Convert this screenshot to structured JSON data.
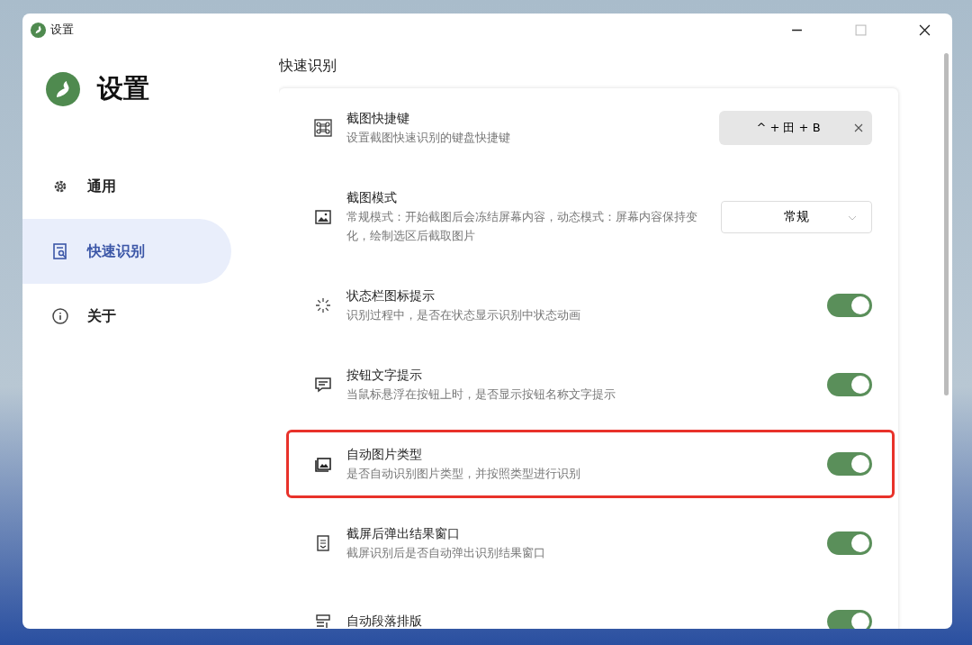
{
  "window": {
    "title": "设置"
  },
  "sidebar": {
    "title": "设置",
    "items": [
      {
        "label": "通用",
        "selected": false
      },
      {
        "label": "快速识别",
        "selected": true
      },
      {
        "label": "关于",
        "selected": false
      }
    ]
  },
  "section_title": "快速识别",
  "settings": [
    {
      "kind": "shortcut",
      "title": "截图快捷键",
      "description": "设置截图快速识别的键盘快捷键",
      "value": "^ + 田 + B"
    },
    {
      "kind": "dropdown",
      "title": "截图模式",
      "description": "常规模式：开始截图后会冻结屏幕内容，动态模式：屏幕内容保持变化，绘制选区后截取图片",
      "value": "常规"
    },
    {
      "kind": "toggle",
      "title": "状态栏图标提示",
      "description": "识别过程中，是否在状态显示识别中状态动画",
      "on": true
    },
    {
      "kind": "toggle",
      "title": "按钮文字提示",
      "description": "当鼠标悬浮在按钮上时，是否显示按钮名称文字提示",
      "on": true
    },
    {
      "kind": "toggle",
      "title": "自动图片类型",
      "description": "是否自动识别图片类型，并按照类型进行识别",
      "on": true,
      "highlighted": true
    },
    {
      "kind": "toggle",
      "title": "截屏后弹出结果窗口",
      "description": "截屏识别后是否自动弹出识别结果窗口",
      "on": true
    },
    {
      "kind": "toggle",
      "title": "自动段落排版",
      "on": true
    }
  ]
}
